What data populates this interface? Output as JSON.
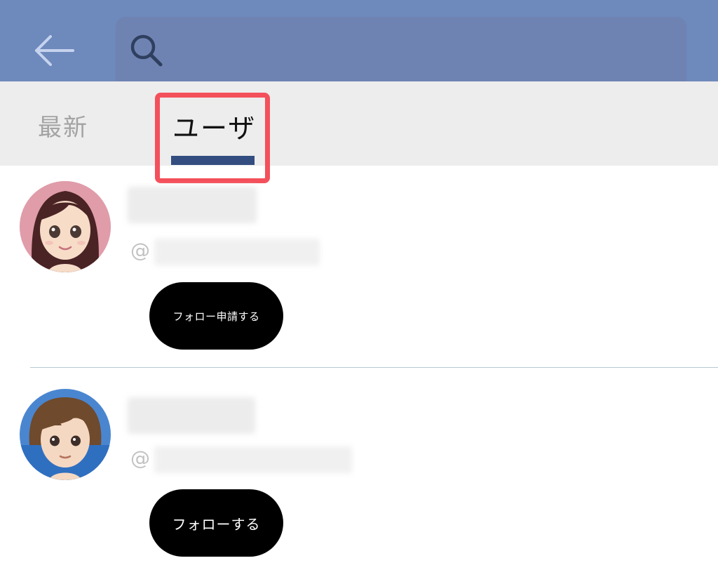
{
  "header": {
    "back_icon": "arrow-left-icon",
    "search_icon": "search-icon",
    "search_value": "",
    "bg_color": "#6e89bc"
  },
  "tabs": [
    {
      "label": "最新",
      "active": false
    },
    {
      "label": "ユーザ",
      "active": true
    }
  ],
  "accent_colors": {
    "tab_underline": "#334d80",
    "highlight": "#f4505b"
  },
  "users": [
    {
      "avatar": "avatar-female",
      "handle_prefix": "@",
      "follow_label": "フォロー申請する"
    },
    {
      "avatar": "avatar-male",
      "handle_prefix": "@",
      "follow_label": "フォローする"
    }
  ]
}
